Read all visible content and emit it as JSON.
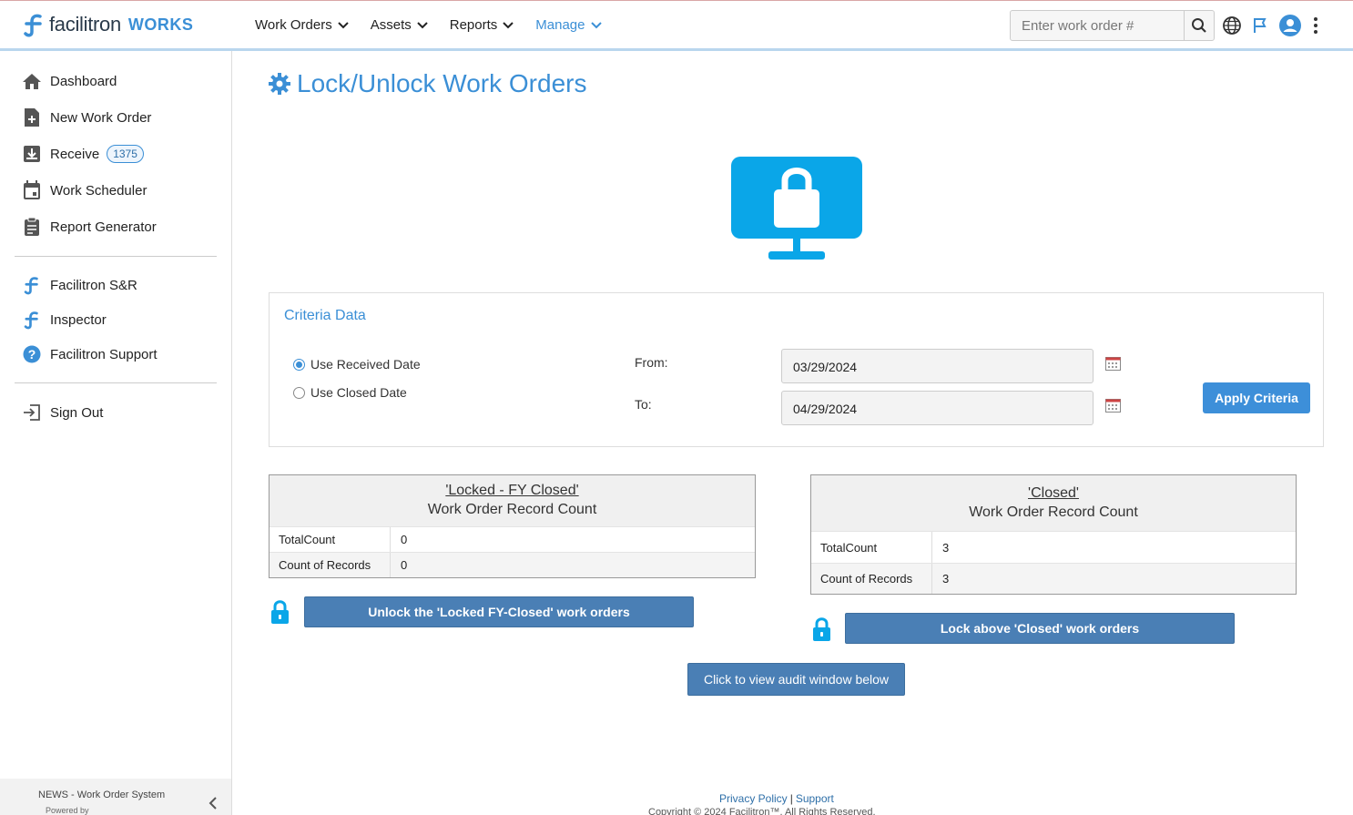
{
  "header": {
    "logo_text": "facilitron",
    "logo_works": "WORKS",
    "nav": [
      {
        "label": "Work Orders"
      },
      {
        "label": "Assets"
      },
      {
        "label": "Reports"
      },
      {
        "label": "Manage"
      }
    ],
    "search_placeholder": "Enter work order #"
  },
  "sidebar": {
    "items": [
      {
        "label": "Dashboard",
        "icon": "home-icon"
      },
      {
        "label": "New Work Order",
        "icon": "new-document-icon"
      },
      {
        "label": "Receive",
        "icon": "inbox-download-icon",
        "badge": "1375"
      },
      {
        "label": "Work Scheduler",
        "icon": "calendar-icon"
      },
      {
        "label": "Report Generator",
        "icon": "clipboard-icon"
      }
    ],
    "links": [
      {
        "label": "Facilitron S&R"
      },
      {
        "label": "Inspector"
      },
      {
        "label": "Facilitron Support"
      }
    ],
    "signout": "Sign Out",
    "footer_news": "NEWS - Work Order System",
    "footer_powered": "Powered by"
  },
  "main": {
    "title": "Lock/Unlock Work Orders",
    "criteria": {
      "title": "Criteria Data",
      "radio_received": "Use Received Date",
      "radio_closed": "Use Closed Date",
      "from_label": "From:",
      "to_label": "To:",
      "from_value": "03/29/2024",
      "to_value": "04/29/2024",
      "apply": "Apply Criteria"
    },
    "locked_box": {
      "title": "'Locked - FY Closed'",
      "subtitle": "Work Order Record Count",
      "total_label": "TotalCount",
      "total_value": "0",
      "count_label": "Count of Records",
      "count_value": "0"
    },
    "closed_box": {
      "title": "'Closed'",
      "subtitle": "Work Order Record Count",
      "total_label": "TotalCount",
      "total_value": "3",
      "count_label": "Count of Records",
      "count_value": "3"
    },
    "unlock_btn": "Unlock the 'Locked FY-Closed' work orders",
    "lock_btn": "Lock above 'Closed' work orders",
    "audit_btn": "Click to view audit window below"
  },
  "footer": {
    "privacy": "Privacy Policy",
    "sep": "|",
    "support": "Support",
    "copyright": "Copyright © 2024 Facilitron™. All Rights Reserved."
  },
  "colors": {
    "accent": "#3b8fd6",
    "button": "#4a7fb5",
    "hero": "#0aa6e8"
  }
}
